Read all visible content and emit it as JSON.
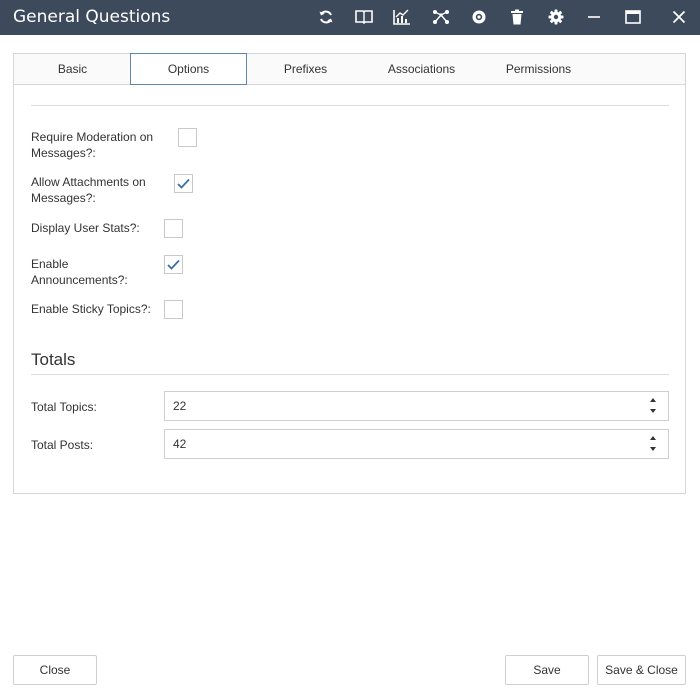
{
  "window": {
    "title": "General Questions",
    "toolbar_icons": [
      "refresh-icon",
      "book-icon",
      "chart-icon",
      "network-icon",
      "settings-alt-icon",
      "trash-icon",
      "gear-icon",
      "minimize-icon",
      "maximize-icon",
      "close-icon"
    ]
  },
  "tabs": [
    {
      "label": "Basic"
    },
    {
      "label": "Options",
      "active": true
    },
    {
      "label": "Prefixes"
    },
    {
      "label": "Associations"
    },
    {
      "label": "Permissions"
    }
  ],
  "options": [
    {
      "line1": "Require Moderation on",
      "line2": "Messages?:",
      "checked": false
    },
    {
      "line1": "Allow Attachments on",
      "line2": "Messages?:",
      "checked": true
    },
    {
      "line1": "Display User Stats?:",
      "line2": "",
      "checked": false
    },
    {
      "line1": "Enable",
      "line2": "Announcements?:",
      "checked": true
    },
    {
      "line1": "Enable Sticky Topics?:",
      "line2": "",
      "checked": false
    }
  ],
  "totals": {
    "heading": "Totals",
    "topics_label": "Total Topics:",
    "topics_value": "22",
    "posts_label": "Total Posts:",
    "posts_value": "42"
  },
  "footer": {
    "close_label": "Close",
    "save_label": "Save",
    "save_close_label": "Save & Close"
  },
  "colors": {
    "titlebar": "#3d4a5c",
    "active_tab_border": "#5b87b0",
    "checkmark": "#3a6ea5"
  }
}
